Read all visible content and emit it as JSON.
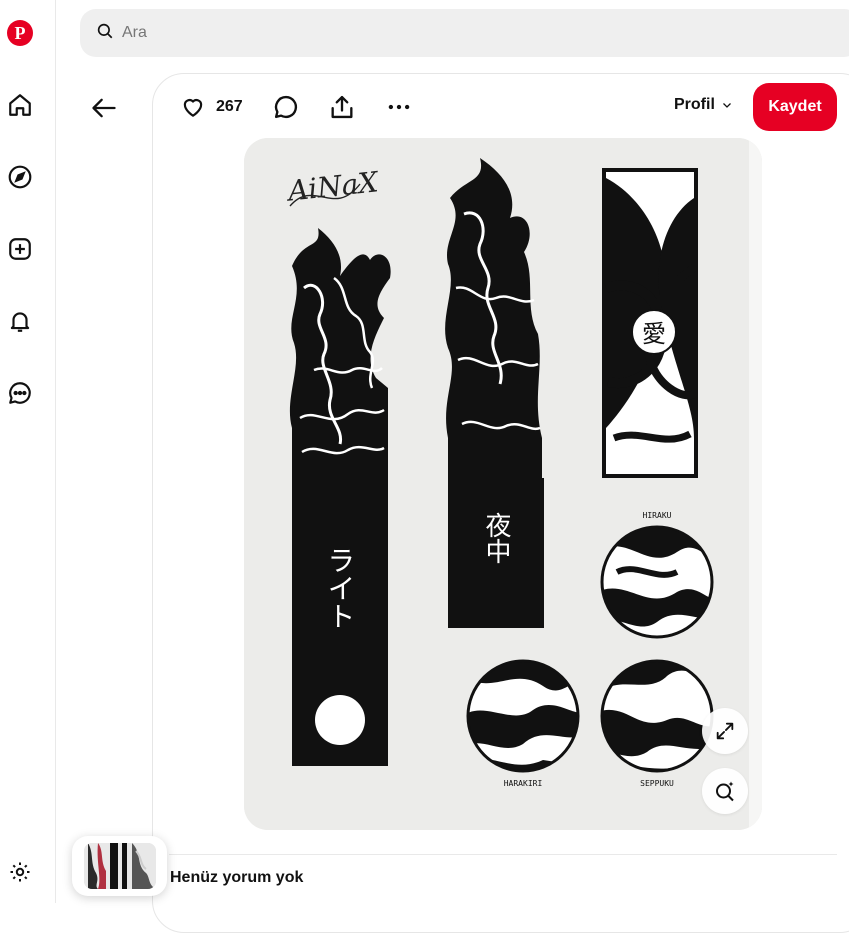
{
  "search": {
    "placeholder": "Ara"
  },
  "sidebar": {
    "items": [
      {
        "icon": "pinterest-logo-icon",
        "label": "P"
      },
      {
        "icon": "home-icon"
      },
      {
        "icon": "explore-compass-icon"
      },
      {
        "icon": "create-plus-icon"
      },
      {
        "icon": "notifications-bell-icon"
      },
      {
        "icon": "messages-icon"
      },
      {
        "icon": "settings-gear-icon"
      }
    ]
  },
  "pin": {
    "like_count": "267",
    "profile_label": "Profil",
    "save_label": "Kaydet",
    "no_comments": "Henüz yorum yok"
  },
  "artwork": {
    "signature": "AiNaX",
    "bar_left_text": "ライト",
    "bar_middle_text": "夜中",
    "panel_glyph": "愛",
    "circle_labels": [
      "HIRAKU",
      "HARAKIRI",
      "SEPPUKU"
    ]
  },
  "colors": {
    "brand": "#e60023",
    "search_bg": "#efefef",
    "art_bg": "#ececea",
    "ink": "#111111"
  }
}
